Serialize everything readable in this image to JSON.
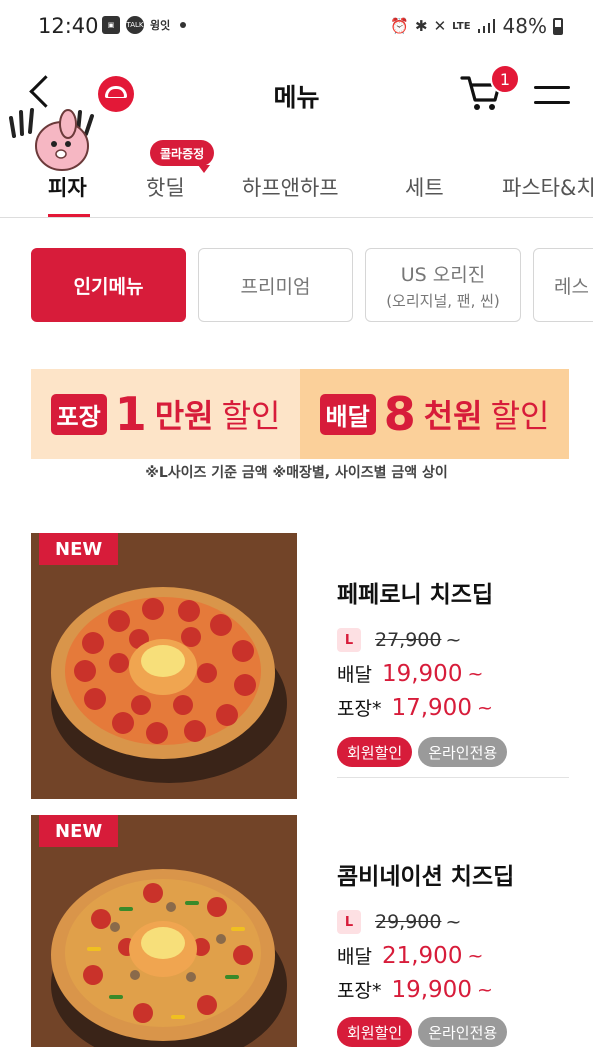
{
  "status_bar": {
    "time": "12:40",
    "left_icons": [
      "gallery-icon",
      "talk-icon"
    ],
    "talk_label": "TALK",
    "app_text": "윙잇",
    "right_icons": [
      "alarm-icon",
      "bluetooth-icon",
      "mute-icon",
      "lte-icon",
      "signal-icon"
    ],
    "battery": "48%"
  },
  "header": {
    "title": "메뉴",
    "cart_count": "1"
  },
  "tabs": {
    "items": [
      "피자",
      "핫딜",
      "하프앤하프",
      "세트",
      "파스타&치"
    ],
    "active": 0,
    "promo_tag": "콜라증정"
  },
  "chips": {
    "items": [
      {
        "label": "인기메뉴",
        "sub": ""
      },
      {
        "label": "프리미엄",
        "sub": ""
      },
      {
        "label": "US 오리진",
        "sub": "(오리지널, 팬, 씬)"
      },
      {
        "label": "레스",
        "sub": ""
      }
    ],
    "active": 0
  },
  "banner": {
    "left": {
      "box": "포장",
      "num": "1",
      "won": "만원",
      "sale": "할인"
    },
    "right": {
      "box": "배달",
      "num": "8",
      "won": "천원",
      "sale": "할인"
    },
    "note": "※L사이즈 기준 금액  ※매장별, 사이즈별 금액 상이"
  },
  "products": [
    {
      "badge": "NEW",
      "name": "페페로니 치즈딥",
      "size": "L",
      "original_price": "27,900",
      "tilde": "~",
      "delivery_label": "배달",
      "delivery_price": "19,900",
      "pickup_label": "포장*",
      "pickup_price": "17,900",
      "tags": [
        "회원할인",
        "온라인전용"
      ]
    },
    {
      "badge": "NEW",
      "name": "콤비네이션 치즈딥",
      "size": "L",
      "original_price": "29,900",
      "tilde": "~",
      "delivery_label": "배달",
      "delivery_price": "21,900",
      "pickup_label": "포장*",
      "pickup_price": "19,900",
      "tags": [
        "회원할인",
        "온라인전용"
      ]
    }
  ],
  "colors": {
    "brand_red": "#d71c3a",
    "banner_left": "#fde4c8",
    "banner_right": "#fbd09a",
    "tag_gray": "#9a9a9a"
  }
}
